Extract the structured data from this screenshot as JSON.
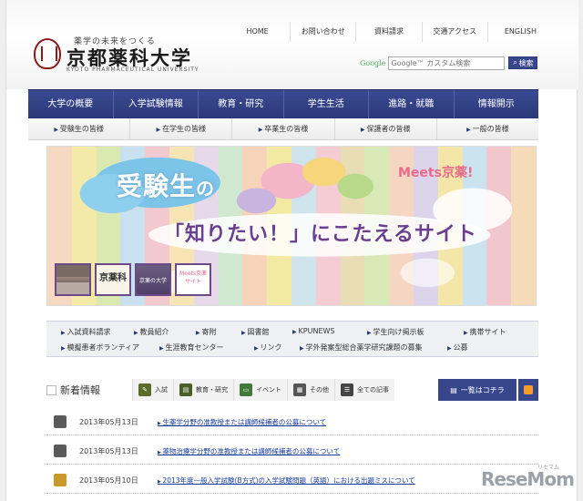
{
  "header": {
    "tagline": "薬学の未来をつくる",
    "university_name": "京都薬科大学",
    "university_name_en": "KYOTO PHARMACEUTICAL UNIVERSITY",
    "top_nav": [
      "HOME",
      "お問い合わせ",
      "資料請求",
      "交通アクセス",
      "ENGLISH"
    ],
    "search": {
      "provider": "Google",
      "placeholder": "Google™ カスタム検索",
      "button_label": "検索"
    }
  },
  "main_nav": [
    "大学の概要",
    "入学試験情報",
    "教育・研究",
    "学生生活",
    "進路・就職",
    "情報開示"
  ],
  "sub_nav": [
    "受験生の皆様",
    "在学生の皆様",
    "卒業生の皆様",
    "保護者の皆様",
    "一般の皆様"
  ],
  "banner": {
    "title_line1": "受験生",
    "title_line1_particle": "の",
    "title_line2": "「知りたい！」にこたえるサイト",
    "brand": "Meets京薬!",
    "thumb2_text": "京薬科",
    "thumb3_text": "京薬の大学",
    "thumb4_text": "Meets京薬 サイト"
  },
  "quick_links": [
    "入試資料請求",
    "教員紹介",
    "寄附",
    "図書館",
    "KPUNEWS",
    "学生向け掲示板",
    "携帯サイト",
    "模擬患者ボランティア",
    "生涯教育センター",
    "リンク",
    "学外発案型総合薬学研究課題の募集",
    "公募"
  ],
  "news": {
    "title": "新着情報",
    "tabs": [
      {
        "label": "入試",
        "color": "#5a6b2a"
      },
      {
        "label": "教育・研究",
        "color": "#4a5e2a"
      },
      {
        "label": "イベント",
        "color": "#3f7a3a"
      },
      {
        "label": "その他",
        "color": "#555555"
      },
      {
        "label": "全ての記事",
        "color": "#444444"
      }
    ],
    "list_button": "一覧はコチラ",
    "items": [
      {
        "date": "2013年05月13日",
        "text": "生薬学分野の准教授または講師候補者の公募について",
        "color": "#5a5a5a"
      },
      {
        "date": "2013年05月13日",
        "text": "薬物治療学分野の准教授または講師候補者の公募について",
        "color": "#5a5a5a"
      },
      {
        "date": "2013年05月10日",
        "text": "2013年度一般入学試験(B方式)の入学試験問題（英語）における出題ミスについて",
        "color": "#c89a2a"
      }
    ]
  },
  "watermark": {
    "text": "ReseMom",
    "small": "リセマム"
  },
  "colors": {
    "nav_bg": "#2b3878",
    "link": "#1a3ca0",
    "accent_pink": "#e96b8c",
    "accent_purple": "#6b3f8f"
  }
}
